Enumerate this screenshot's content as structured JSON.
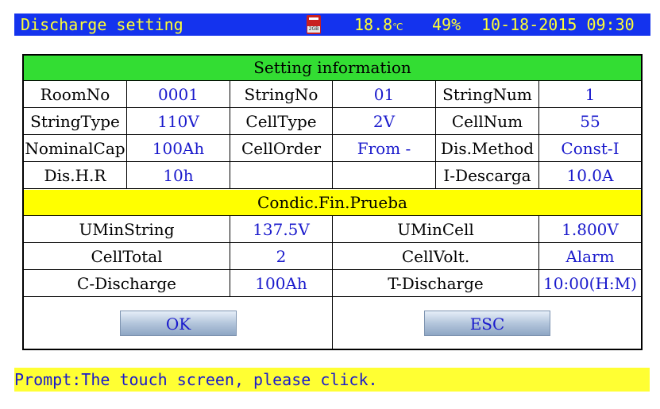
{
  "topbar": {
    "title": "Discharge setting",
    "sd_label": "2GB",
    "temperature": "18.8",
    "temperature_unit": "℃",
    "battery": "49%",
    "datetime": "10-18-2015 09:30"
  },
  "setting_header": "Setting information",
  "rows": [
    [
      "RoomNo",
      "0001",
      "StringNo",
      "01",
      "StringNum",
      "1"
    ],
    [
      "StringType",
      "110V",
      "CellType",
      "2V",
      "CellNum",
      "55"
    ],
    [
      "NominalCap",
      "100Ah",
      "CellOrder",
      "From -",
      "Dis.Method",
      "Const-I"
    ],
    [
      "Dis.H.R",
      "10h",
      "",
      "",
      "I-Descarga",
      "10.0A"
    ]
  ],
  "end_header": "Condic.Fin.Prueba",
  "end_rows": [
    [
      "UMinString",
      "137.5V",
      "UMinCell",
      "1.800V"
    ],
    [
      "CellTotal",
      "2",
      "CellVolt.",
      "Alarm"
    ],
    [
      "C-Discharge",
      "100Ah",
      "T-Discharge",
      "10:00(H:M)"
    ]
  ],
  "buttons": {
    "ok": "OK",
    "esc": "ESC"
  },
  "prompt": "Prompt:The touch screen, please click."
}
